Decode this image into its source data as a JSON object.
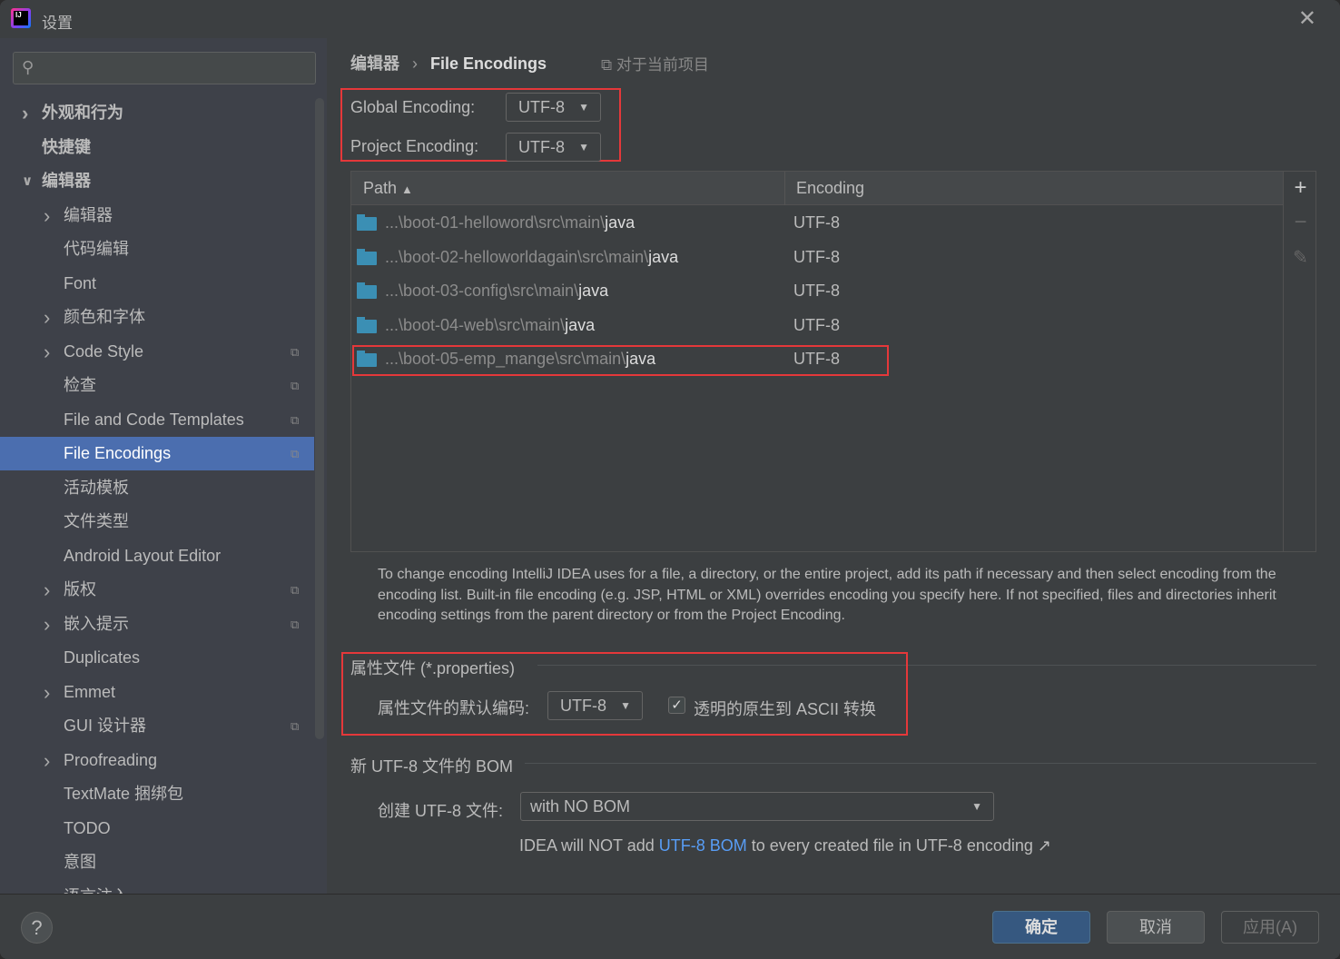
{
  "window": {
    "title": "设置",
    "close_icon": "close-icon"
  },
  "sidebar": {
    "search_placeholder": "",
    "items": [
      {
        "label": "外观和行为",
        "level": 0,
        "arrow": "right",
        "bold": true
      },
      {
        "label": "快捷键",
        "level": 0,
        "bold": true
      },
      {
        "label": "编辑器",
        "level": 0,
        "arrow": "down",
        "bold": true
      },
      {
        "label": "编辑器",
        "level": 1,
        "arrow": "right"
      },
      {
        "label": "代码编辑",
        "level": 1
      },
      {
        "label": "Font",
        "level": 1
      },
      {
        "label": "颜色和字体",
        "level": 1,
        "arrow": "right"
      },
      {
        "label": "Code Style",
        "level": 1,
        "arrow": "right",
        "project": true
      },
      {
        "label": "检查",
        "level": 1,
        "project": true
      },
      {
        "label": "File and Code Templates",
        "level": 1,
        "project": true
      },
      {
        "label": "File Encodings",
        "level": 1,
        "project": true,
        "selected": true
      },
      {
        "label": "活动模板",
        "level": 1
      },
      {
        "label": "文件类型",
        "level": 1
      },
      {
        "label": "Android Layout Editor",
        "level": 1
      },
      {
        "label": "版权",
        "level": 1,
        "arrow": "right",
        "project": true
      },
      {
        "label": "嵌入提示",
        "level": 1,
        "arrow": "right",
        "project": true
      },
      {
        "label": "Duplicates",
        "level": 1
      },
      {
        "label": "Emmet",
        "level": 1,
        "arrow": "right"
      },
      {
        "label": "GUI 设计器",
        "level": 1,
        "project": true
      },
      {
        "label": "Proofreading",
        "level": 1,
        "arrow": "right"
      },
      {
        "label": "TextMate 捆绑包",
        "level": 1
      },
      {
        "label": "TODO",
        "level": 1
      },
      {
        "label": "意图",
        "level": 1
      },
      {
        "label": "语言注入",
        "level": 1,
        "arrow": "right",
        "project": true
      }
    ]
  },
  "main": {
    "breadcrumb": [
      "编辑器",
      "File Encodings"
    ],
    "project_scope": "对于当前项目",
    "global_encoding_label": "Global Encoding:",
    "global_encoding": "UTF-8",
    "project_encoding_label": "Project Encoding:",
    "project_encoding": "UTF-8",
    "table": {
      "columns": [
        "Path",
        "Encoding"
      ],
      "sort": "Path ascending",
      "rows": [
        {
          "prefix": "...\\boot-01-helloword\\src\\main\\",
          "name": "java",
          "encoding": "UTF-8"
        },
        {
          "prefix": "...\\boot-02-helloworldagain\\src\\main\\",
          "name": "java",
          "encoding": "UTF-8"
        },
        {
          "prefix": "...\\boot-03-config\\src\\main\\",
          "name": "java",
          "encoding": "UTF-8"
        },
        {
          "prefix": "...\\boot-04-web\\src\\main\\",
          "name": "java",
          "encoding": "UTF-8"
        },
        {
          "prefix": "...\\boot-05-emp_mange\\src\\main\\",
          "name": "java",
          "encoding": "UTF-8"
        }
      ]
    },
    "description": "To change encoding IntelliJ IDEA uses for a file, a directory, or the entire project, add its path if necessary and then select encoding from the encoding list. Built-in file encoding (e.g. JSP, HTML or XML) overrides encoding you specify here. If not specified, files and directories inherit encoding settings from the parent directory or from the Project Encoding.",
    "properties": {
      "title": "属性文件 (*.properties)",
      "default_label": "属性文件的默认编码:",
      "default_encoding": "UTF-8",
      "ascii_label": "透明的原生到 ASCII 转换",
      "ascii_checked": true
    },
    "bom": {
      "title": "新 UTF-8 文件的 BOM",
      "create_label": "创建 UTF-8 文件:",
      "create_value": "with NO BOM",
      "note_pre": "IDEA will NOT add ",
      "note_link": "UTF-8 BOM",
      "note_post": " to every created file in UTF-8 encoding ↗"
    }
  },
  "footer": {
    "help": "?",
    "ok": "确定",
    "cancel": "取消",
    "apply": "应用(A)"
  },
  "colors": {
    "selection": "#4b6eaf",
    "highlight_box": "#e5383a",
    "link": "#589df6",
    "ok_button": "#365880"
  }
}
